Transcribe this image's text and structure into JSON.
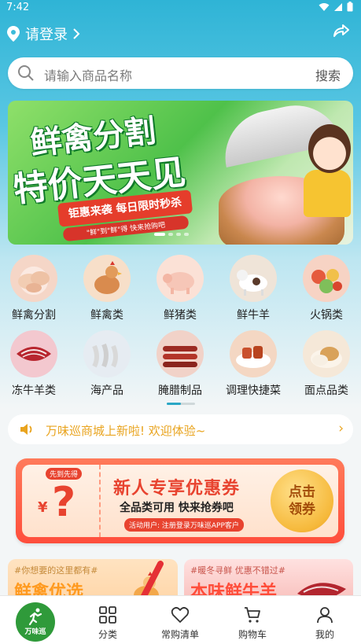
{
  "status": {
    "time": "7:42"
  },
  "header": {
    "login_text": "请登录"
  },
  "search": {
    "placeholder": "请输入商品名称",
    "button": "搜索"
  },
  "banner": {
    "title_line1": "鲜禽分割",
    "title_line2": "特价天天见",
    "ribbon": "钜惠来袭  每日限时秒杀",
    "sub": "\"鲜\"到\"鲜\"得 快来抢购吧"
  },
  "categories": [
    {
      "label": "鲜禽分割",
      "icon": "chicken-parts-icon",
      "color": "#f5d6c7"
    },
    {
      "label": "鲜禽类",
      "icon": "chicken-icon",
      "color": "#f7dfc9"
    },
    {
      "label": "鲜猪类",
      "icon": "pig-icon",
      "color": "#fbe1d6"
    },
    {
      "label": "鲜牛羊",
      "icon": "cattle-icon",
      "color": "#efe4d8"
    },
    {
      "label": "火锅类",
      "icon": "hotpot-icon",
      "color": "#f7d3c4"
    },
    {
      "label": "冻牛羊类",
      "icon": "frozen-meat-icon",
      "color": "#f3c8cf"
    },
    {
      "label": "海产品",
      "icon": "shrimp-icon",
      "color": "#e6ecf2"
    },
    {
      "label": "腌腊制品",
      "icon": "sausage-icon",
      "color": "#f1d2c8"
    },
    {
      "label": "调理快捷菜",
      "icon": "prepared-dish-icon",
      "color": "#f4d7c3"
    },
    {
      "label": "面点品类",
      "icon": "pastry-icon",
      "color": "#f5e8d8"
    }
  ],
  "notice": {
    "text": "万味巡商城上新啦! 欢迎体验~"
  },
  "coupon": {
    "tag": "先到先得",
    "yen": "¥",
    "question": "?",
    "title": "新人专享优惠券",
    "subtitle": "全品类可用 快来抢券吧",
    "note": "活动用户: 注册登录万味巡APP客户",
    "button_line1": "点击",
    "button_line2": "领券"
  },
  "promos": [
    {
      "small": "#你想要的这里都有#",
      "big": "鲜禽优选"
    },
    {
      "small": "#暖冬寻鲜 优惠不错过#",
      "big": "本味鲜牛羊"
    }
  ],
  "tabbar": {
    "home_badge": "万味巡",
    "items": [
      {
        "label": "分类",
        "icon": "category-grid-icon"
      },
      {
        "label": "常购清单",
        "icon": "heart-icon"
      },
      {
        "label": "购物车",
        "icon": "cart-icon"
      },
      {
        "label": "我的",
        "icon": "person-icon"
      }
    ]
  },
  "colors": {
    "accent": "#2fb4d6",
    "notice": "#e9a41f",
    "coupon_red": "#e8432f"
  }
}
